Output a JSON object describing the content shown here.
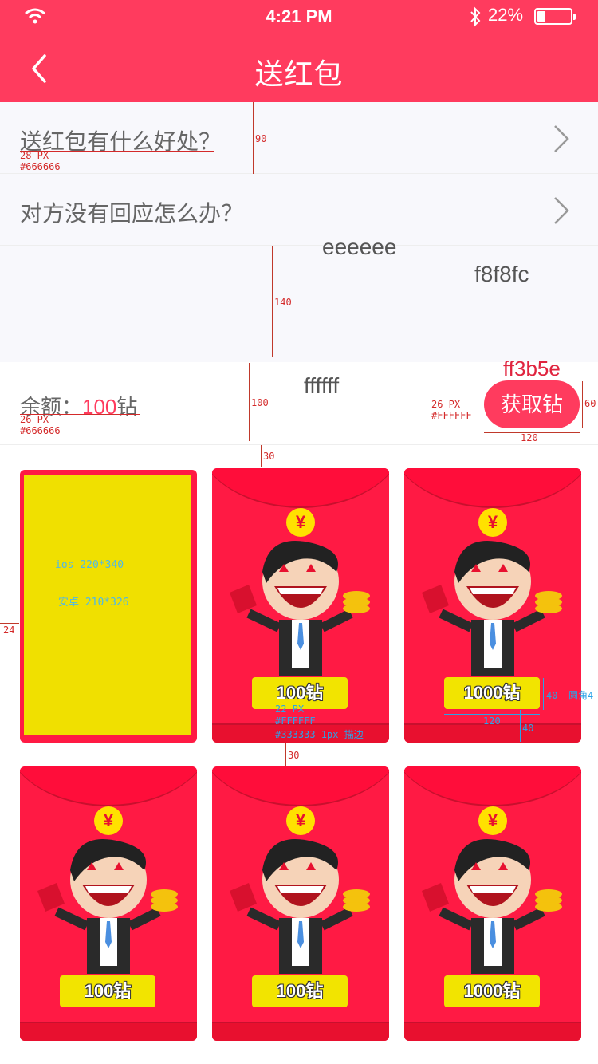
{
  "status_bar": {
    "time": "4:21 PM",
    "battery": "22%"
  },
  "nav": {
    "title": "送红包"
  },
  "faq": [
    {
      "label": "送红包有什么好处？"
    },
    {
      "label": "对方没有回应怎么办？"
    }
  ],
  "balance": {
    "prefix": "余额：",
    "amount": "100",
    "unit": "钻"
  },
  "get_button": {
    "label": "获取钻"
  },
  "envelope_symbol": "¥",
  "envelopes": [
    {
      "amount": "100钻"
    },
    {
      "amount": "1000钻"
    },
    {
      "amount": "100钻"
    },
    {
      "amount": "100钻"
    },
    {
      "amount": "1000钻"
    }
  ],
  "placeholder": {
    "ios": "ios  220*340",
    "android": "安卓  210*326"
  },
  "annotations": {
    "faq_size": "28 PX",
    "faq_color": "#666666",
    "faq_height": "90",
    "color_eeeeee": "eeeeee",
    "color_f8f8fc": "f8f8fc",
    "gap_height": "140",
    "color_ffffff": "ffffff",
    "color_ff3b5e": "ff3b5e",
    "balance_row_height": "100",
    "balance_size": "26 PX",
    "balance_color": "#666666",
    "btn_size": "26 PX",
    "btn_color": "#FFFFFF",
    "btn_height": "60",
    "btn_width": "120",
    "grid_top_gap": "30",
    "side_margin": "24",
    "amount_size": "22 PX",
    "amount_color": "#FFFFFF",
    "amount_stroke": "#333333  1px 描边",
    "row_gap": "30",
    "tag_height": "40",
    "tag_radius": "圆角4",
    "tag_width": "120",
    "tag_bottom": "40"
  },
  "colors": {
    "accent": "#ff3b5e",
    "text": "#666666",
    "divider": "#eeeeee",
    "background": "#f8f8fc",
    "tag": "#f2e400"
  }
}
